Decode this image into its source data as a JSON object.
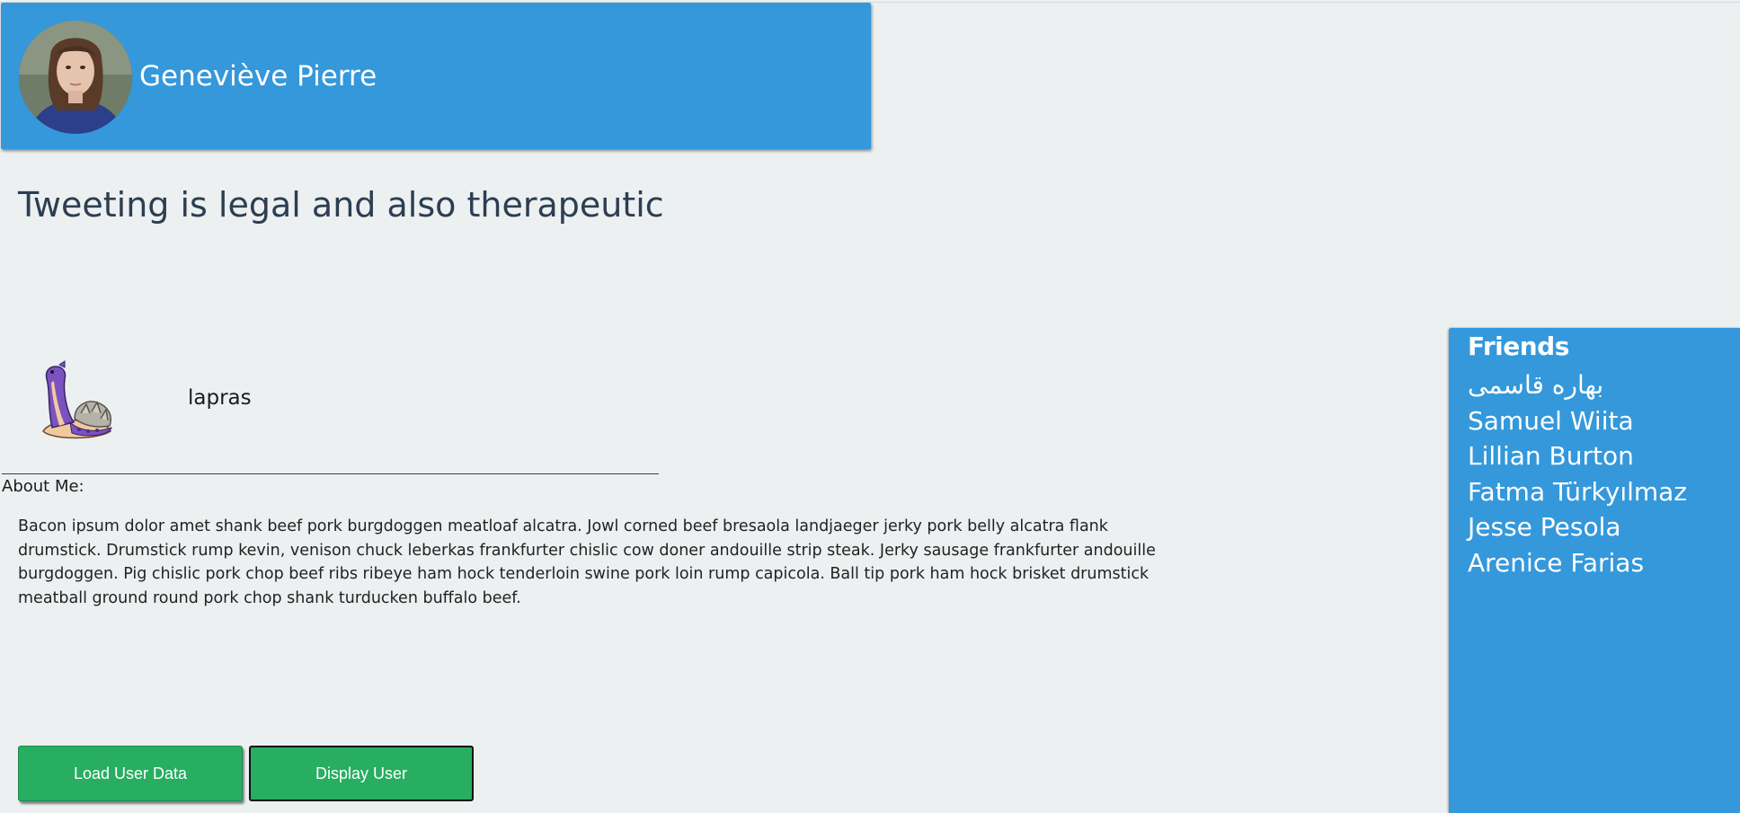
{
  "header": {
    "name": "Geneviève Pierre"
  },
  "status": "Tweeting is legal and also therapeutic",
  "pokemon": {
    "name": "lapras"
  },
  "about": {
    "label": "About Me:",
    "text": "Bacon ipsum dolor amet shank beef pork burgdoggen meatloaf alcatra. Jowl corned beef bresaola landjaeger jerky pork belly alcatra flank drumstick. Drumstick rump kevin, venison chuck leberkas frankfurter chislic cow doner andouille strip steak. Jerky sausage frankfurter andouille burgdoggen. Pig chislic pork chop beef ribs ribeye ham hock tenderloin swine pork loin rump capicola. Ball tip pork ham hock brisket drumstick meatball ground round pork chop shank turducken buffalo beef."
  },
  "buttons": {
    "load_label": "Load User Data",
    "display_label": "Display User"
  },
  "friends": {
    "title": "Friends",
    "items": [
      "بهاره قاسمی",
      "Samuel Wiita",
      "Lillian Burton",
      "Fatma Türkyılmaz",
      "Jesse Pesola",
      "Arenice Farias"
    ]
  },
  "colors": {
    "background": "#ecf0f1",
    "header": "#3498db",
    "button": "#27ae60",
    "text": "#2c3e50"
  }
}
